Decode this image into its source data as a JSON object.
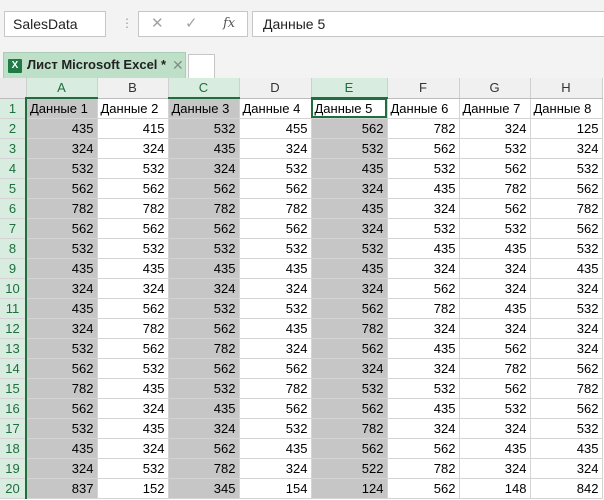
{
  "formula_bar": {
    "name_box": "SalesData",
    "separator": "⋮",
    "cancel_icon": "✕",
    "enter_icon": "✓",
    "fx_icon": "fx",
    "formula_value": "Данные 5"
  },
  "workbook_tab": {
    "title": "Лист Microsoft Excel *",
    "close_icon": "✕",
    "app_icon_letter": "X"
  },
  "grid": {
    "column_headers": [
      "A",
      "B",
      "C",
      "D",
      "E",
      "F",
      "G",
      "H"
    ],
    "selected_columns": [
      "A",
      "C",
      "E"
    ],
    "active_cell": "E1",
    "rows": [
      {
        "n": "1",
        "cells": [
          "Данные 1",
          "Данные 2",
          "Данные 3",
          "Данные 4",
          "Данные 5",
          "Данные 6",
          "Данные 7",
          "Данные 8"
        ]
      },
      {
        "n": "2",
        "cells": [
          "435",
          "415",
          "532",
          "455",
          "562",
          "782",
          "324",
          "125"
        ]
      },
      {
        "n": "3",
        "cells": [
          "324",
          "324",
          "435",
          "324",
          "532",
          "562",
          "532",
          "324"
        ]
      },
      {
        "n": "4",
        "cells": [
          "532",
          "532",
          "324",
          "532",
          "435",
          "532",
          "562",
          "532"
        ]
      },
      {
        "n": "5",
        "cells": [
          "562",
          "562",
          "562",
          "562",
          "324",
          "435",
          "782",
          "562"
        ]
      },
      {
        "n": "6",
        "cells": [
          "782",
          "782",
          "782",
          "782",
          "435",
          "324",
          "562",
          "782"
        ]
      },
      {
        "n": "7",
        "cells": [
          "562",
          "562",
          "562",
          "562",
          "324",
          "532",
          "532",
          "562"
        ]
      },
      {
        "n": "8",
        "cells": [
          "532",
          "532",
          "532",
          "532",
          "532",
          "435",
          "435",
          "532"
        ]
      },
      {
        "n": "9",
        "cells": [
          "435",
          "435",
          "435",
          "435",
          "435",
          "324",
          "324",
          "435"
        ]
      },
      {
        "n": "10",
        "cells": [
          "324",
          "324",
          "324",
          "324",
          "324",
          "562",
          "324",
          "324"
        ]
      },
      {
        "n": "11",
        "cells": [
          "435",
          "562",
          "532",
          "532",
          "562",
          "782",
          "435",
          "532"
        ]
      },
      {
        "n": "12",
        "cells": [
          "324",
          "782",
          "562",
          "435",
          "782",
          "324",
          "324",
          "324"
        ]
      },
      {
        "n": "13",
        "cells": [
          "532",
          "562",
          "782",
          "324",
          "562",
          "435",
          "562",
          "324"
        ]
      },
      {
        "n": "14",
        "cells": [
          "562",
          "532",
          "562",
          "562",
          "324",
          "324",
          "782",
          "562"
        ]
      },
      {
        "n": "15",
        "cells": [
          "782",
          "435",
          "532",
          "782",
          "532",
          "532",
          "562",
          "782"
        ]
      },
      {
        "n": "16",
        "cells": [
          "562",
          "324",
          "435",
          "562",
          "562",
          "435",
          "532",
          "562"
        ]
      },
      {
        "n": "17",
        "cells": [
          "532",
          "435",
          "324",
          "532",
          "782",
          "324",
          "324",
          "532"
        ]
      },
      {
        "n": "18",
        "cells": [
          "435",
          "324",
          "562",
          "435",
          "562",
          "562",
          "435",
          "435"
        ]
      },
      {
        "n": "19",
        "cells": [
          "324",
          "532",
          "782",
          "324",
          "522",
          "782",
          "324",
          "324"
        ]
      },
      {
        "n": "20",
        "cells": [
          "837",
          "152",
          "345",
          "154",
          "124",
          "562",
          "148",
          "842"
        ]
      }
    ]
  },
  "colors": {
    "accent": "#1e6e3e",
    "selection_fill": "#c6c6c6",
    "tab_fill": "#bfe0c8"
  }
}
